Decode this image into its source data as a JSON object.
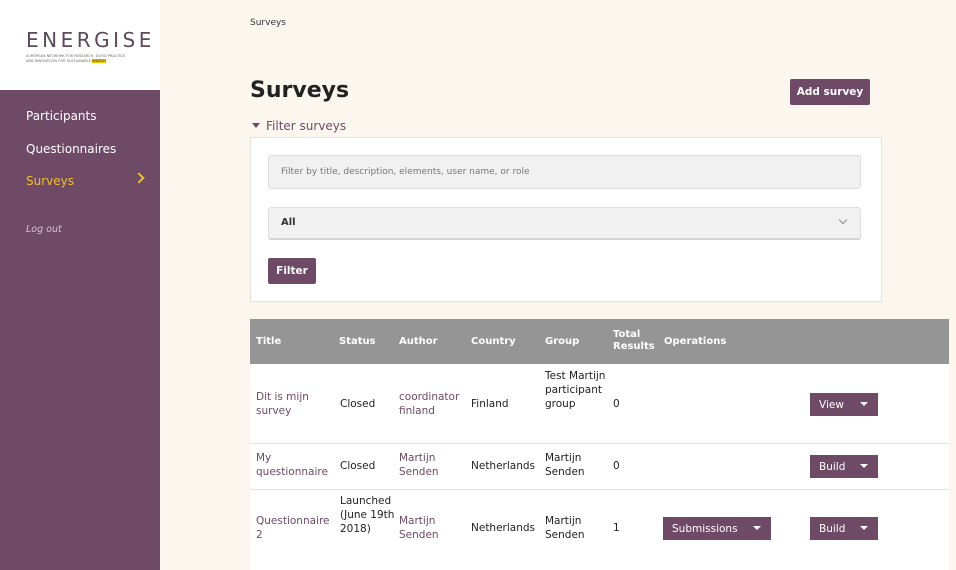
{
  "brand": {
    "logo_text": "ENERGISE",
    "logo_tagline_1": "EUROPEAN NETWORK FOR RESEARCH, GOOD PRACTICE",
    "logo_tagline_2": "AND INNOVATION FOR SUSTAINABLE",
    "logo_tagline_highlight": "ENERGY"
  },
  "sidebar": {
    "items": [
      {
        "label": "Participants",
        "active": false
      },
      {
        "label": "Questionnaires",
        "active": false
      },
      {
        "label": "Surveys",
        "active": true
      }
    ],
    "logout_label": "Log out",
    "accent_color": "#f0c020",
    "bg_color": "#6e4a66"
  },
  "breadcrumb": "Surveys",
  "page_title": "Surveys",
  "add_button": "Add survey",
  "filter": {
    "toggle_label": "Filter surveys",
    "search_placeholder": "Filter by title, description, elements, user name, or role",
    "search_value": "",
    "select_value": "All",
    "button_label": "Filter"
  },
  "table": {
    "headers": [
      "Title",
      "Status",
      "Author",
      "Country",
      "Group",
      "Total Results",
      "Operations"
    ],
    "rows": [
      {
        "title": "Dit is mijn survey",
        "status": "Closed",
        "author": "coordinator finland",
        "country": "Finland",
        "group": "Test Martijn participant group",
        "total": "0",
        "op_primary": "",
        "op_action": "View"
      },
      {
        "title": "My questionnaire",
        "status": "Closed",
        "author": "Martijn Senden",
        "country": "Netherlands",
        "group": "Martijn Senden",
        "total": "0",
        "op_primary": "",
        "op_action": "Build"
      },
      {
        "title": "Questionnaire 2",
        "status": "Launched (June 19th 2018)",
        "author": "Martijn Senden",
        "country": "Netherlands",
        "group": "Martijn Senden",
        "total": "1",
        "op_primary": "Submissions",
        "op_action": "Build"
      }
    ]
  },
  "colors": {
    "primary": "#6e4a66",
    "page_bg": "#fcf7ee",
    "table_header": "#959595"
  }
}
